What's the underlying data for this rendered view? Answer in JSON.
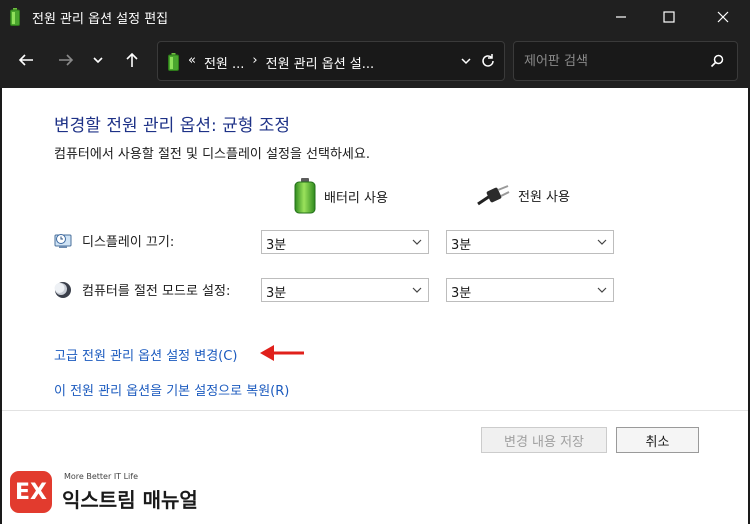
{
  "window": {
    "title": "전원 관리 옵션 설정 편집"
  },
  "address_bar": {
    "prefix": "«",
    "crumbs": [
      "전원 ...",
      "›",
      "전원 관리 옵션 설..."
    ]
  },
  "search": {
    "placeholder": "제어판 검색"
  },
  "page": {
    "heading": "변경할 전원 관리 옵션: 균형 조정",
    "subtext": "컴퓨터에서 사용할 절전 및 디스플레이 설정을 선택하세요."
  },
  "columns": {
    "battery": "배터리 사용",
    "plugged": "전원 사용"
  },
  "settings": [
    {
      "label": "디스플레이 끄기:",
      "battery_value": "3분",
      "plugged_value": "3분"
    },
    {
      "label": "컴퓨터를 절전 모드로 설정:",
      "battery_value": "3분",
      "plugged_value": "3분"
    }
  ],
  "links": {
    "advanced": "고급 전원 관리 옵션 설정 변경(C)",
    "restore": "이 전원 관리 옵션을 기본 설정으로 복원(R)"
  },
  "buttons": {
    "save": "변경 내용 저장",
    "cancel": "취소"
  },
  "watermark": {
    "tagline": "More Better IT Life",
    "name": "익스트림 매뉴얼"
  },
  "colors": {
    "heading": "#1e3287",
    "link": "#1c5bbf",
    "arrow": "#e0201b",
    "logo": "#e23b2e"
  },
  "icons": {
    "app": "battery-icon",
    "back": "arrow-left-icon",
    "forward": "arrow-right-icon",
    "recent": "chevron-down-icon",
    "up": "arrow-up-icon",
    "refresh": "refresh-icon",
    "search": "search-icon",
    "display_row": "display-clock-icon",
    "sleep_row": "moon-icon",
    "plug": "power-plug-icon"
  }
}
